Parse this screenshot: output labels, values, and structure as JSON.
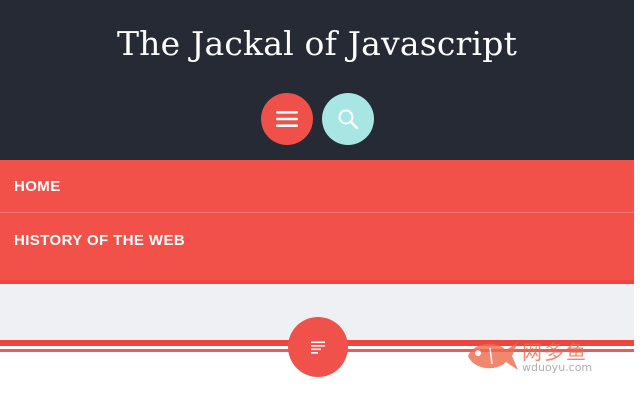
{
  "header": {
    "title": "The Jackal of Javascript",
    "menu_button_icon": "hamburger-menu-icon",
    "search_button_icon": "search-icon"
  },
  "nav": {
    "items": [
      {
        "label": "HOME"
      },
      {
        "label": "HISTORY OF THE WEB"
      }
    ]
  },
  "content": {
    "toggle_icon": "text-lines-icon"
  },
  "watermark": {
    "text": "网多鱼",
    "sub": "wduoyu.com"
  },
  "colors": {
    "header_bg": "#252a34",
    "accent_red": "#f2514a",
    "search_teal": "#a8e6e4",
    "band_gray": "#eef0f3"
  }
}
